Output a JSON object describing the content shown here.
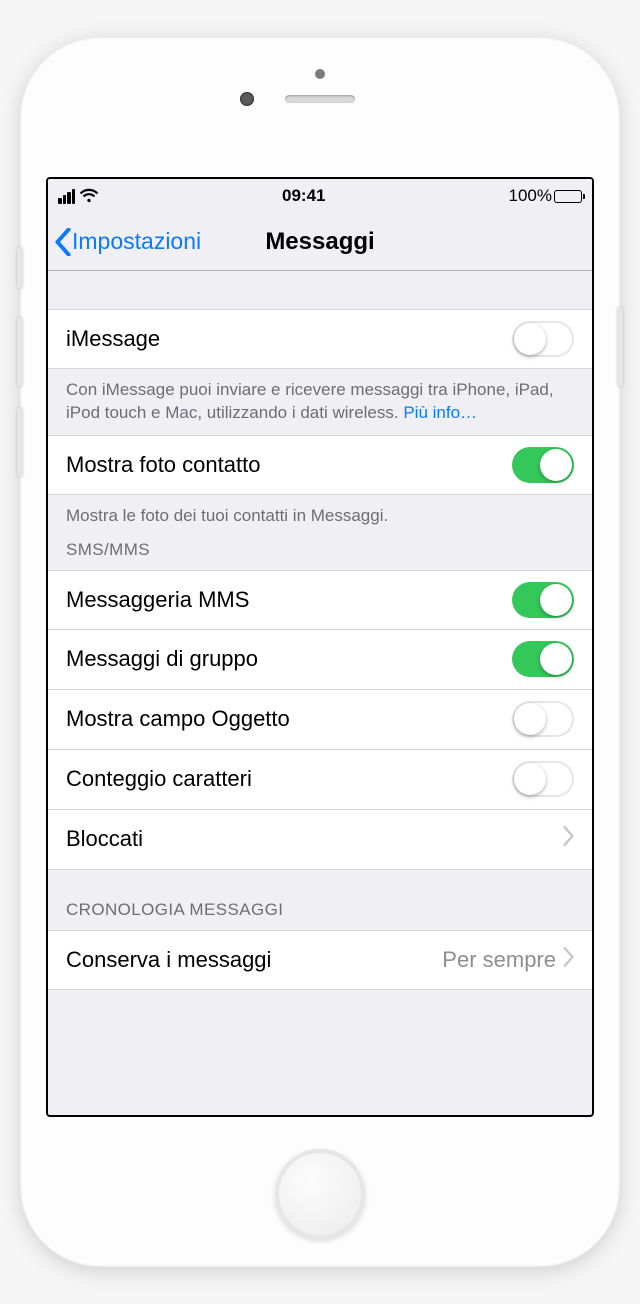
{
  "statusbar": {
    "time": "09:41",
    "battery_pct": "100%"
  },
  "nav": {
    "back_label": "Impostazioni",
    "title": "Messaggi"
  },
  "sections": {
    "s1": {
      "imessage_label": "iMessage",
      "imessage_on": false,
      "footer_text": "Con iMessage puoi inviare e ricevere messaggi tra iPhone, iPad, iPod touch e Mac, utilizzando i dati wireless. ",
      "footer_link": "Più info…"
    },
    "s2": {
      "show_contact_photo_label": "Mostra foto contatto",
      "show_contact_photo_on": true,
      "footer_text": "Mostra le foto dei tuoi contatti in Messaggi."
    },
    "s3": {
      "header": "SMS/MMS",
      "mms_label": "Messaggeria MMS",
      "mms_on": true,
      "group_label": "Messaggi di gruppo",
      "group_on": true,
      "subject_label": "Mostra campo Oggetto",
      "subject_on": false,
      "char_label": "Conteggio caratteri",
      "char_on": false,
      "blocked_label": "Bloccati"
    },
    "s4": {
      "header": "CRONOLOGIA MESSAGGI",
      "keep_label": "Conserva i messaggi",
      "keep_value": "Per sempre"
    }
  }
}
